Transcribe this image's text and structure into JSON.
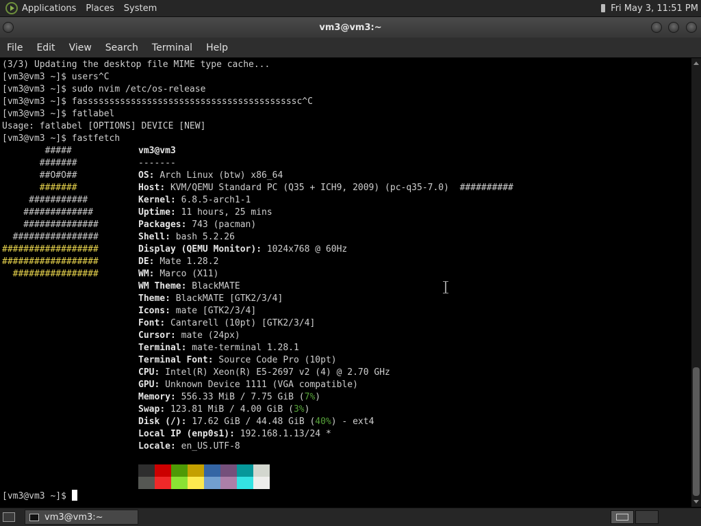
{
  "top_panel": {
    "menus": [
      "Applications",
      "Places",
      "System"
    ],
    "clock": "Fri May  3, 11:51 PM"
  },
  "window": {
    "title": "vm3@vm3:~"
  },
  "menubar": {
    "items": [
      "File",
      "Edit",
      "View",
      "Search",
      "Terminal",
      "Help"
    ]
  },
  "terminal": {
    "history": [
      "(3/3) Updating the desktop file MIME type cache...",
      "[vm3@vm3 ~]$ users^C",
      "[vm3@vm3 ~]$ sudo nvim /etc/os-release",
      "[vm3@vm3 ~]$ fassssssssssssssssssssssssssssssssssssssssc^C",
      "[vm3@vm3 ~]$ fatlabel",
      "Usage: fatlabel [OPTIONS] DEVICE [NEW]",
      "[vm3@vm3 ~]$ fastfetch"
    ],
    "logo": [
      "        #####",
      "       #######",
      "       ##O#O##",
      "       #######",
      "     ###########",
      "    #############",
      "    ##############",
      "  ################",
      "##################",
      "##################",
      "  ################"
    ],
    "fastfetch": {
      "title": "vm3@vm3",
      "divider": "-------",
      "rows": [
        {
          "key": "OS",
          "value": "Arch Linux (btw) x86_64"
        },
        {
          "key": "Host",
          "value": "KVM/QEMU Standard PC (Q35 + ICH9, 2009) (pc-q35-7.0)  ##########"
        },
        {
          "key": "Kernel",
          "value": "6.8.5-arch1-1"
        },
        {
          "key": "Uptime",
          "value": "11 hours, 25 mins"
        },
        {
          "key": "Packages",
          "value": "743 (pacman)"
        },
        {
          "key": "Shell",
          "value": "bash 5.2.26"
        },
        {
          "key": "Display (QEMU Monitor)",
          "value": "1024x768 @ 60Hz"
        },
        {
          "key": "DE",
          "value": "Mate 1.28.2"
        },
        {
          "key": "WM",
          "value": "Marco (X11)"
        },
        {
          "key": "WM Theme",
          "value": "BlackMATE"
        },
        {
          "key": "Theme",
          "value": "BlackMATE [GTK2/3/4]"
        },
        {
          "key": "Icons",
          "value": "mate [GTK2/3/4]"
        },
        {
          "key": "Font",
          "value": "Cantarell (10pt) [GTK2/3/4]"
        },
        {
          "key": "Cursor",
          "value": "mate (24px)"
        },
        {
          "key": "Terminal",
          "value": "mate-terminal 1.28.1"
        },
        {
          "key": "Terminal Font",
          "value": "Source Code Pro (10pt)"
        },
        {
          "key": "CPU",
          "value": "Intel(R) Xeon(R) E5-2697 v2 (4) @ 2.70 GHz"
        },
        {
          "key": "GPU",
          "value": "Unknown Device 1111 (VGA compatible)"
        },
        {
          "key": "Memory",
          "value_pre": "556.33 MiB / 7.75 GiB (",
          "pct": "7%",
          "value_post": ")"
        },
        {
          "key": "Swap",
          "value_pre": "123.81 MiB / 4.00 GiB (",
          "pct": "3%",
          "value_post": ")"
        },
        {
          "key": "Disk (/)",
          "value_pre": "17.62 GiB / 44.48 GiB (",
          "pct": "40%",
          "value_post": ") - ext4"
        },
        {
          "key": "Local IP (enp0s1)",
          "value": "192.168.1.13/24 *"
        },
        {
          "key": "Locale",
          "value": "en_US.UTF-8"
        }
      ],
      "palette_top": [
        "#2e2e2e",
        "#cc0000",
        "#4e9a06",
        "#c4a000",
        "#3465a4",
        "#75507b",
        "#06989a",
        "#d3d7cf"
      ],
      "palette_bottom": [
        "#555753",
        "#ef2929",
        "#8ae234",
        "#fce94f",
        "#729fcf",
        "#ad7fa8",
        "#34e2e2",
        "#eeeeec"
      ]
    },
    "prompt": "[vm3@vm3 ~]$ "
  },
  "bottom_panel": {
    "task_label": "vm3@vm3:~"
  },
  "colors": {
    "logo_yellow": "#e8d44d",
    "percent_green": "#57a33a"
  }
}
